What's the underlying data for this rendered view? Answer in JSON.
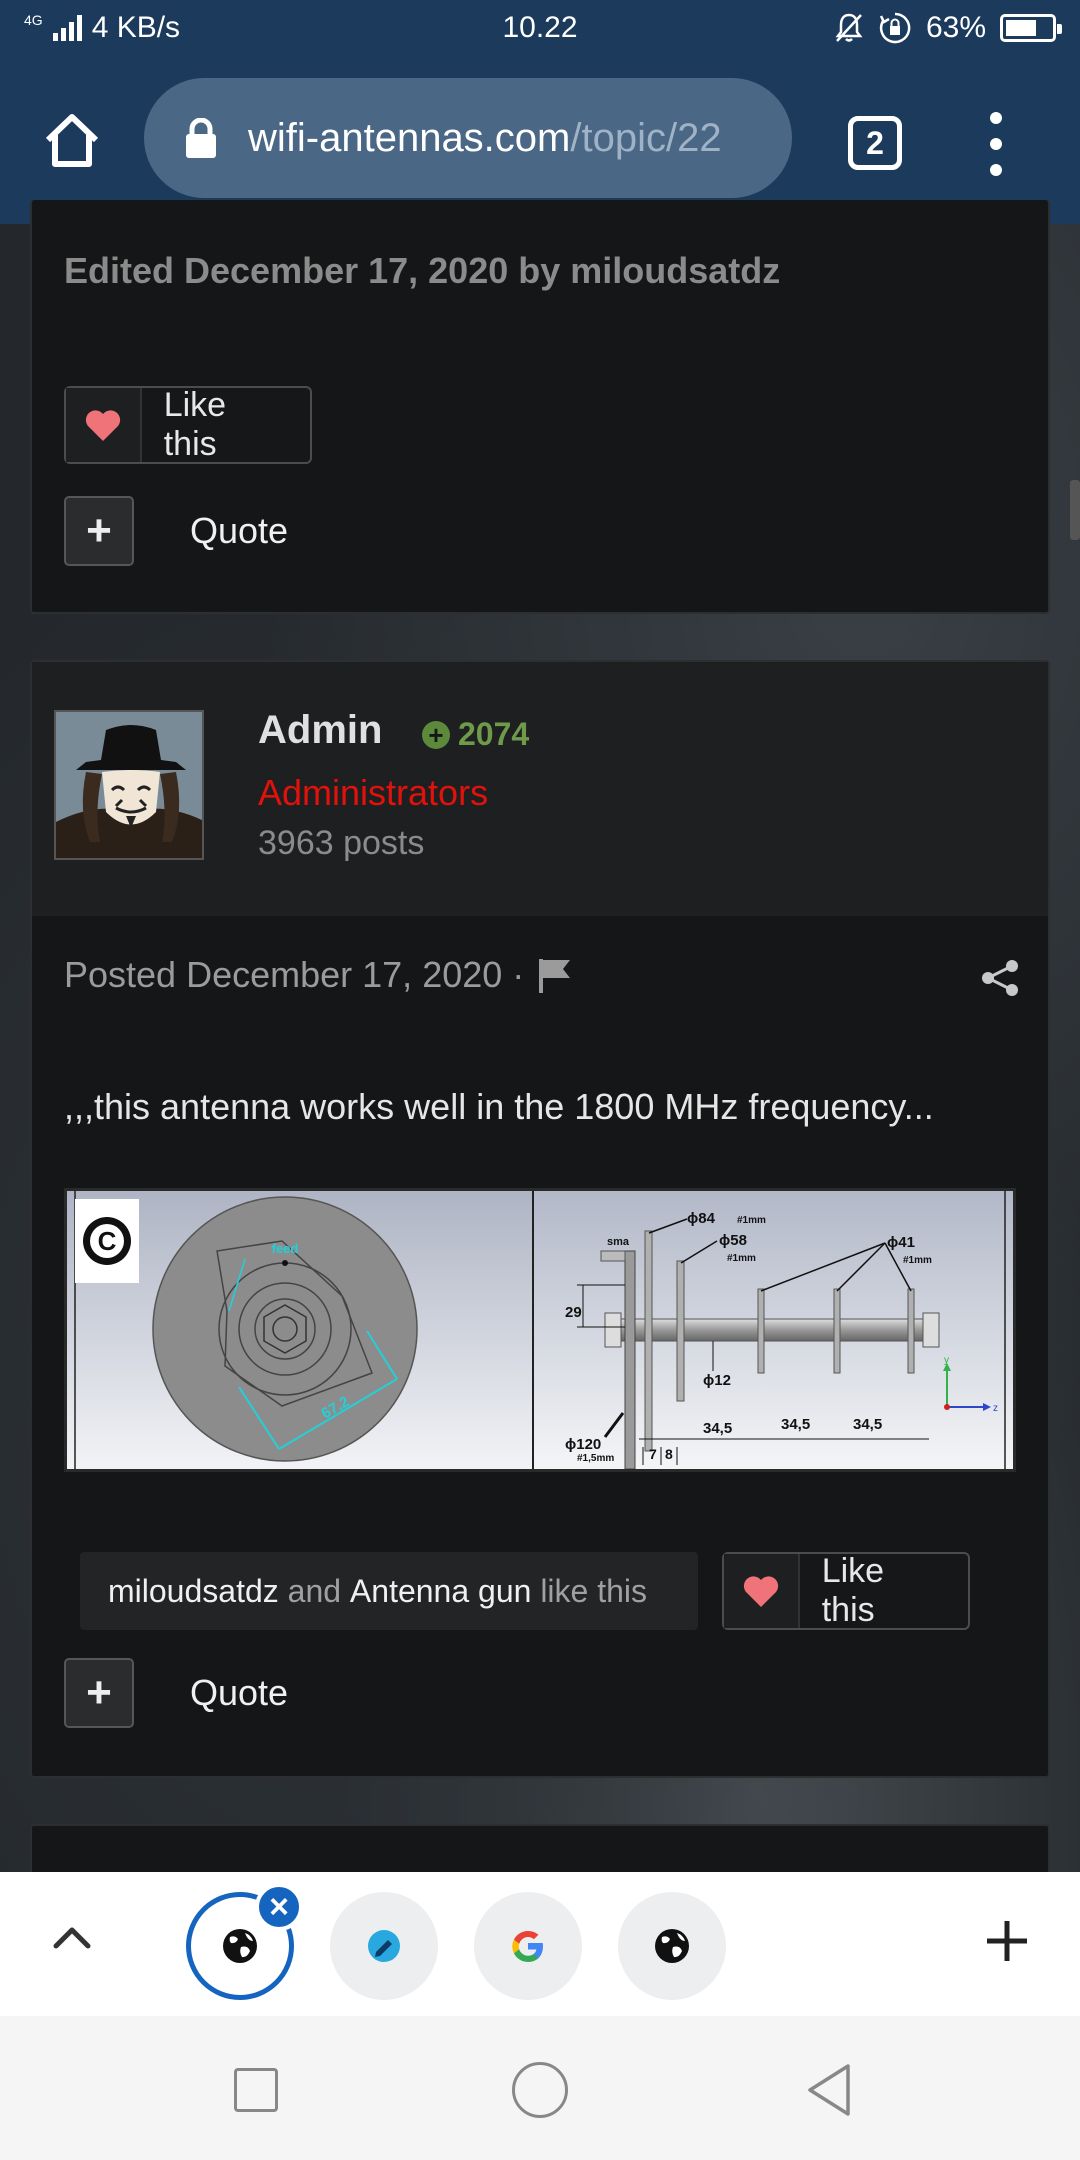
{
  "status_bar": {
    "network": "4G",
    "speed": "4 KB/s",
    "time": "10.22",
    "battery": "63%"
  },
  "browser": {
    "url_domain": "wifi-antennas.com",
    "url_path": "/topic/22",
    "tab_count": "2"
  },
  "previous_post": {
    "edited_note": "Edited December 17, 2020 by miloudsatdz",
    "like_label": "Like this",
    "quote_label": "Quote"
  },
  "post": {
    "author": "Admin",
    "reputation": "2074",
    "role": "Administrators",
    "post_count": "3963 posts",
    "posted": "Posted December 17, 2020 ·",
    "text": ",,,this antenna works well in the 1800 MHz frequency...",
    "likers": {
      "user1": "miloudsatdz",
      "and": "and",
      "user2": "Antenna gun",
      "suffix": "like this"
    },
    "like_label": "Like this",
    "quote_label": "Quote"
  },
  "drawing": {
    "copyright": "C",
    "feed": "feed",
    "dim_67": "67,2",
    "sma": "sma",
    "d84": "ϕ84",
    "d84_t": "#1mm",
    "d58": "ϕ58",
    "d58_t": "#1mm",
    "d41": "ϕ41",
    "d41_t": "#1mm",
    "h29": "29",
    "d12": "ϕ12",
    "d120": "ϕ120",
    "d120_t": "#1,5mm",
    "s7": "7",
    "s8": "8",
    "s1": "34,5",
    "s2": "34,5",
    "s3": "34,5",
    "axis_y": "y",
    "axis_z": "z"
  },
  "colors": {
    "topbar": "#1c3a5c",
    "heart": "#f0737a",
    "role": "#e0120b",
    "reputation": "#6e9a4a",
    "active_tab": "#1565c0"
  }
}
